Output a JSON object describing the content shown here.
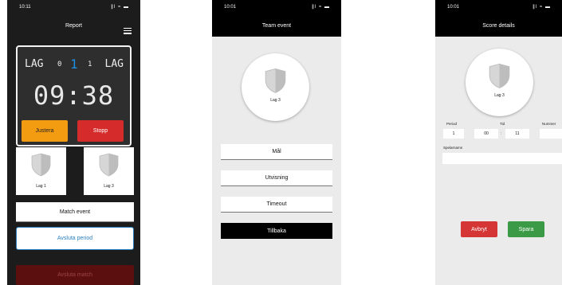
{
  "screens": [
    {
      "status_time": "10:11",
      "status_icons": "∥l ≈ ▬",
      "title": "Report",
      "scoreboard": {
        "left_team": "LAG",
        "left_score": "0",
        "period": "1",
        "right_score": "1",
        "right_team": "LAG",
        "clock": "09:38",
        "adjust_label": "Justera",
        "stop_label": "Stopp"
      },
      "teams": [
        {
          "name": "Lag 1"
        },
        {
          "name": "Lag 3"
        }
      ],
      "match_event_label": "Match event",
      "end_period_label": "Avsluta period",
      "end_match_label": "Avsluta match"
    },
    {
      "status_time": "10:01",
      "status_icons": "∥l ≈ ▬",
      "title": "Team event",
      "team_name": "Lag 3",
      "buttons": [
        "Mål",
        "Utvisning",
        "Timeout"
      ],
      "back_label": "Tillbaka"
    },
    {
      "status_time": "10:01",
      "status_icons": "∥l ≈ ▬",
      "title": "Score details",
      "team_name": "Lag 3",
      "period_label": "Period",
      "period_value": "1",
      "time_label": "Tid",
      "minutes_value": "00",
      "seconds_value": "11",
      "time_separator": ":",
      "number_label": "Nummer",
      "number_value": "",
      "player_name_label": "Spelarnamn",
      "player_name_value": "",
      "cancel_label": "Avbryt",
      "save_label": "Spara"
    }
  ],
  "colors": {
    "accent_blue": "#1e8fe0",
    "adjust_orange": "#f39c12",
    "stop_red": "#d62b2b",
    "save_green": "#3a9a45"
  }
}
